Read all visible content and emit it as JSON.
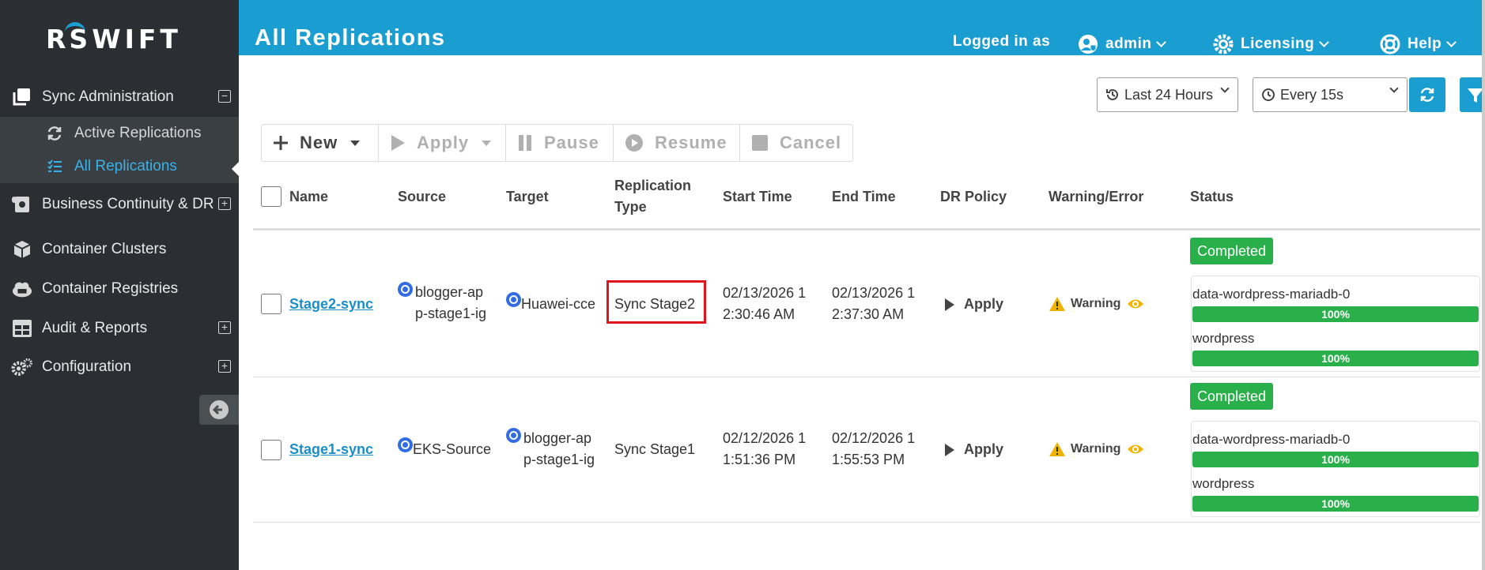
{
  "app": {
    "logo": "SWIFT"
  },
  "header": {
    "title": "All Replications",
    "logged_in_label": "Logged in as",
    "user": "admin",
    "licensing": "Licensing",
    "help": "Help"
  },
  "sidebar": {
    "items": [
      {
        "label": "Sync Administration",
        "icon": "copy-icon",
        "toggle": "⊟"
      },
      {
        "label": "Active Replications",
        "icon": "refresh-icon"
      },
      {
        "label": "All Replications",
        "icon": "list-icon"
      },
      {
        "label": "Business Continuity & DR",
        "icon": "scroll-icon",
        "toggle": "⊞"
      },
      {
        "label": "Container Clusters",
        "icon": "cube-icon"
      },
      {
        "label": "Container Registries",
        "icon": "cloud-icon"
      },
      {
        "label": "Audit & Reports",
        "icon": "table-icon",
        "toggle": "⊞"
      },
      {
        "label": "Configuration",
        "icon": "gears-icon",
        "toggle": "⊞"
      }
    ]
  },
  "filters": {
    "range": "Last 24 Hours",
    "interval": "Every 15s"
  },
  "toolbar": {
    "new": "New",
    "apply": "Apply",
    "pause": "Pause",
    "resume": "Resume",
    "cancel": "Cancel"
  },
  "table": {
    "columns": [
      "Name",
      "Source",
      "Target",
      "Replication\nType",
      "Start Time",
      "End Time",
      "DR Policy",
      "Warning/Error",
      "Status"
    ],
    "rows": [
      {
        "name": "Stage2-sync",
        "source": "blogger-ap\np-stage1-ig",
        "target": "Huawei-cce",
        "type": "Sync Stage2",
        "start": "02/13/2026 1\n2:30:46 AM",
        "end": "02/13/2026 1\n2:37:30 AM",
        "policy": "Apply",
        "warning": "Warning",
        "status": "Completed",
        "volumes": [
          {
            "name": "data-wordpress-mariadb-0",
            "progress": "100%"
          },
          {
            "name": "wordpress",
            "progress": "100%"
          }
        ]
      },
      {
        "name": "Stage1-sync",
        "source": "EKS-Source",
        "target": "blogger-ap\np-stage1-ig",
        "type": "Sync Stage1",
        "start": "02/12/2026 1\n1:51:36 PM",
        "end": "02/12/2026 1\n1:55:53 PM",
        "policy": "Apply",
        "warning": "Warning",
        "status": "Completed",
        "volumes": [
          {
            "name": "data-wordpress-mariadb-0",
            "progress": "100%"
          },
          {
            "name": "wordpress",
            "progress": "100%"
          }
        ]
      }
    ]
  },
  "colors": {
    "brand": "#1a9dd0",
    "sidebar": "#2b2f33",
    "success": "#2ab04a",
    "warning": "#f0b400",
    "highlight": "#e0141b"
  }
}
